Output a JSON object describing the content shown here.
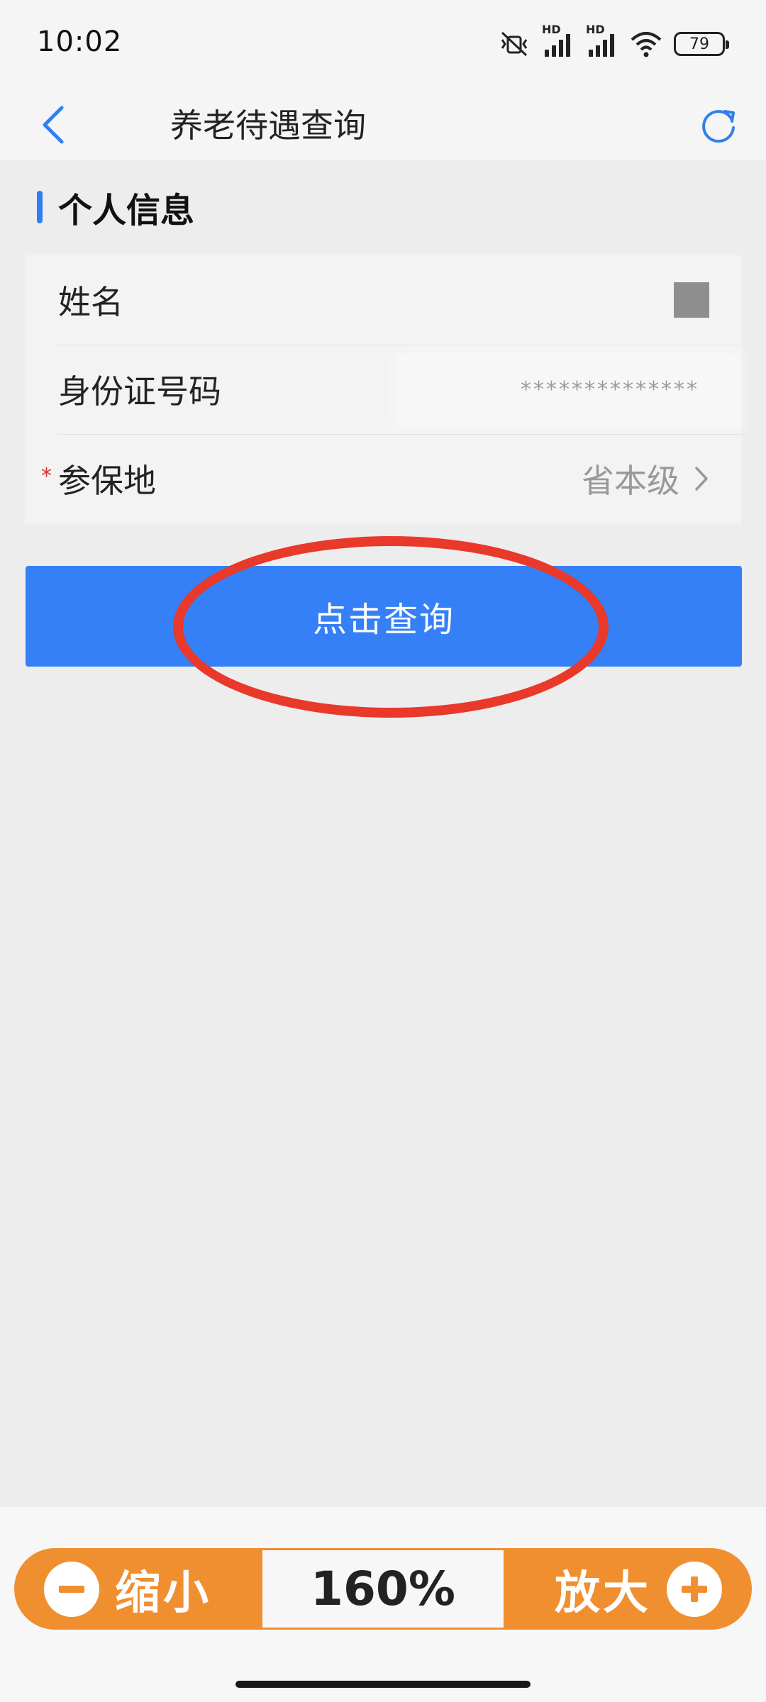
{
  "status_bar": {
    "time": "10:02",
    "signal_tag_1": "HD",
    "signal_tag_2": "HD",
    "battery": "79",
    "icons": [
      "mute-vibrate-icon",
      "signal-icon",
      "signal-icon",
      "wifi-icon",
      "battery-icon"
    ]
  },
  "nav": {
    "title": "养老待遇查询",
    "back_icon": "chevron-left-icon",
    "refresh_icon": "refresh-icon",
    "accent_color": "#2f7ff0"
  },
  "section": {
    "title": "个人信息"
  },
  "form": {
    "rows": [
      {
        "label": "姓名",
        "value": ""
      },
      {
        "label": "身份证号码",
        "value": "**************"
      },
      {
        "label": "参保地",
        "value": "省本级",
        "required_mark": "*"
      }
    ]
  },
  "query_button": {
    "label": "点击查询",
    "color": "#3580f6",
    "highlight_color": "#e8392a"
  },
  "zoom_control": {
    "zoom_out_label": "缩小",
    "zoom_in_label": "放大",
    "zoom_level": "160%",
    "color": "#f08f30"
  }
}
